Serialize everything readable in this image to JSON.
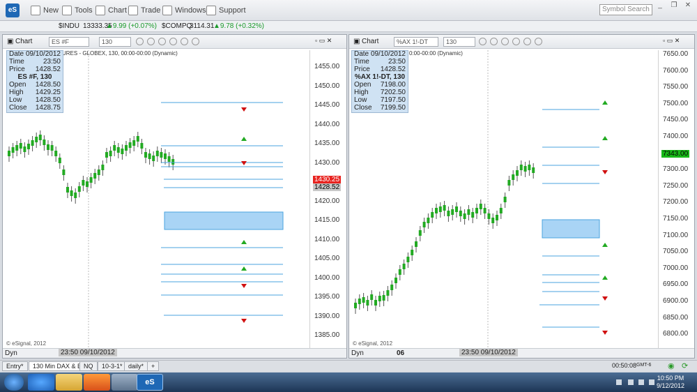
{
  "toolbar": {
    "logo": "eS",
    "buttons": [
      "New",
      "Tools",
      "Chart",
      "Trade",
      "Windows",
      "Support"
    ],
    "search_placeholder": "Symbol Search"
  },
  "ticker": [
    {
      "symbol": "$INDU",
      "price": "13333.35",
      "change": "▲9.99 (+0.07%)"
    },
    {
      "symbol": "$COMPQ",
      "price": "3114.31",
      "change": "▲9.78 (+0.32%)"
    }
  ],
  "left_chart": {
    "title": "Chart",
    "symbol": "ES #F",
    "interval": "130",
    "header_text": "URES - GLOBEX, 130, 00:00-00:00 (Dynamic)",
    "data_window": {
      "date": "09/10/2012",
      "time": "23:50",
      "price": "1428.52",
      "title": "ES #F, 130",
      "open": "1428.50",
      "high": "1429.25",
      "low": "1428.50",
      "close": "1428.75"
    },
    "labels": {
      "date": "Date",
      "time": "Time",
      "price": "Price",
      "open": "Open",
      "high": "High",
      "low": "Low",
      "close": "Close"
    },
    "axis_ticks": [
      "1455.00",
      "1450.00",
      "1445.00",
      "1440.00",
      "1435.00",
      "1430.00",
      "1425.00",
      "1420.00",
      "1415.00",
      "1410.00",
      "1405.00",
      "1400.00",
      "1395.00",
      "1390.00",
      "1385.00"
    ],
    "last_price": "1430.25",
    "cursor_price": "1428.52",
    "copyright": "© eSignal, 2012",
    "footer_label": "Dyn",
    "time_cursor": "23:50 09/10/2012"
  },
  "right_chart": {
    "title": "Chart",
    "symbol": "%AX 1!-DT",
    "interval": "130",
    "header_text": "0:00-00:00 (Dynamic)",
    "data_window": {
      "date": "09/10/2012",
      "time": "23:50",
      "price": "1428.52",
      "title": "%AX 1!-DT, 130",
      "open": "7198.00",
      "high": "7202.50",
      "low": "7197.50",
      "close": "7199.50"
    },
    "labels": {
      "date": "Date",
      "time": "Time",
      "price": "Price",
      "open": "Open",
      "high": "High",
      "low": "Low",
      "close": "Close"
    },
    "axis_ticks": [
      "7650.00",
      "7600.00",
      "7550.00",
      "7500.00",
      "7450.00",
      "7400.00",
      "7350.00",
      "7300.00",
      "7250.00",
      "7200.00",
      "7150.00",
      "7100.00",
      "7050.00",
      "7000.00",
      "6950.00",
      "6900.00",
      "6850.00",
      "6800.00"
    ],
    "last_price": "7343.00",
    "copyright": "© eSignal, 2012",
    "footer_label": "Dyn",
    "footer_date": "06",
    "time_cursor": "23:50 09/10/2012"
  },
  "tabs": [
    "Entry*",
    "130 Min DAX & ES*",
    "NQ",
    "10-3-1*",
    "daily*",
    "+"
  ],
  "status_time": "00:50:08",
  "status_tz": "GMT-6",
  "taskbar": {
    "time": "10:50 PM",
    "date": "9/12/2012"
  },
  "colors": {
    "up": "#22aa22",
    "down": "#d01010",
    "level_line": "#4aa3df",
    "zone": "#a9d4f5",
    "last_price_left": "#e8231f",
    "last_price_right": "#18b818"
  }
}
